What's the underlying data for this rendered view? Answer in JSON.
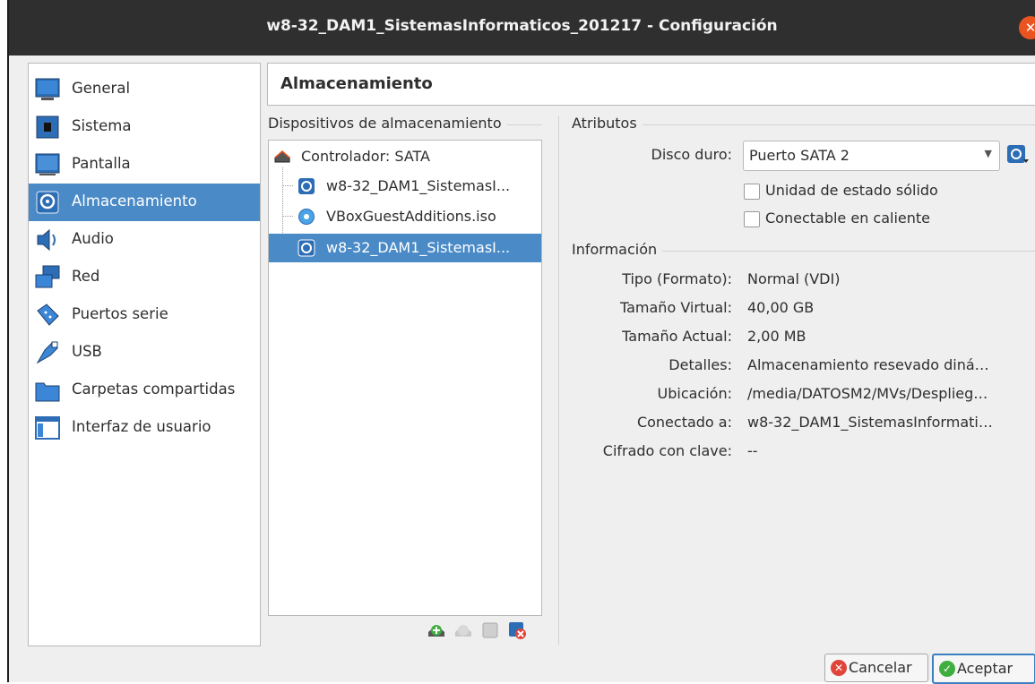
{
  "window": {
    "title": "w8-32_DAM1_SistemasInformaticos_201217 - Configuración"
  },
  "nav": {
    "items": [
      {
        "label": "General",
        "icon": "monitor-icon"
      },
      {
        "label": "Sistema",
        "icon": "chip-icon"
      },
      {
        "label": "Pantalla",
        "icon": "display-icon"
      },
      {
        "label": "Almacenamiento",
        "icon": "disk-icon"
      },
      {
        "label": "Audio",
        "icon": "speaker-icon"
      },
      {
        "label": "Red",
        "icon": "network-icon"
      },
      {
        "label": "Puertos serie",
        "icon": "serial-port-icon"
      },
      {
        "label": "USB",
        "icon": "usb-icon"
      },
      {
        "label": "Carpetas compartidas",
        "icon": "folder-icon"
      },
      {
        "label": "Interfaz de usuario",
        "icon": "window-icon"
      }
    ],
    "selected_index": 3
  },
  "page": {
    "title": "Almacenamiento"
  },
  "storage": {
    "group_title": "Dispositivos de almacenamiento",
    "controller": "Controlador: SATA",
    "devices": [
      "w8-32_DAM1_SistemasI...",
      "VBoxGuestAdditions.iso",
      "w8-32_DAM1_SistemasI..."
    ]
  },
  "attributes": {
    "group_title": "Atributos",
    "disk_label": "Disco duro:",
    "disk_value": "Puerto SATA 2",
    "ssd_label": "Unidad de estado sólido",
    "hotplug_label": "Conectable en caliente"
  },
  "info": {
    "group_title": "Información",
    "rows": [
      {
        "label": "Tipo (Formato):",
        "value": "Normal (VDI)"
      },
      {
        "label": "Tamaño Virtual:",
        "value": "40,00 GB"
      },
      {
        "label": "Tamaño Actual:",
        "value": "2,00 MB"
      },
      {
        "label": "Detalles:",
        "value": "Almacenamiento resevado diná…"
      },
      {
        "label": "Ubicación:",
        "value": "/media/DATOSM2/MVs/Desplieg…"
      },
      {
        "label": "Conectado a:",
        "value": "w8-32_DAM1_SistemasInformati…"
      },
      {
        "label": "Cifrado con clave:",
        "value": "--"
      }
    ]
  },
  "buttons": {
    "cancel": "Cancelar",
    "accept": "Aceptar"
  },
  "colors": {
    "selection": "#4a8ac6",
    "titlebar": "#2f2f2f",
    "close": "#e95420"
  }
}
